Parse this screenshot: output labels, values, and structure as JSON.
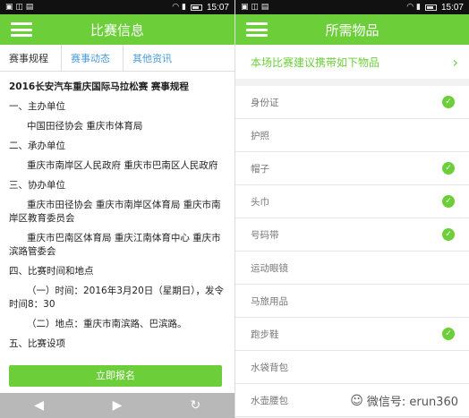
{
  "status": {
    "time": "15:07",
    "left_glyphs": "▣ ◫ ▤",
    "right_glyphs": "◠ ▮"
  },
  "left": {
    "title": "比赛信息",
    "tabs": [
      "赛事规程",
      "赛事动态",
      "其他资讯"
    ],
    "doc_title": "2016长安汽车重庆国际马拉松赛 赛事规程",
    "lines": [
      {
        "text": "一、主办单位",
        "style": ""
      },
      {
        "text": "中国田径协会  重庆市体育局",
        "style": "indent"
      },
      {
        "text": "二、承办单位",
        "style": ""
      },
      {
        "text": "重庆市南岸区人民政府  重庆市巴南区人民政府",
        "style": "indent"
      },
      {
        "text": "三、协办单位",
        "style": ""
      },
      {
        "text": "重庆市田径协会  重庆市南岸区体育局  重庆市南岸区教育委员会",
        "style": "indent-para"
      },
      {
        "text": "重庆市巴南区体育局  重庆江南体育中心  重庆市滨路管委会",
        "style": "indent-para"
      },
      {
        "text": "四、比赛时间和地点",
        "style": ""
      },
      {
        "text": "（一）时间：2016年3月20日（星期日），发令时间8：30",
        "style": "indent-para"
      },
      {
        "text": "（二）地点：重庆市南滨路、巴滨路。",
        "style": "indent-para"
      },
      {
        "text": "五、比赛设项",
        "style": ""
      }
    ],
    "signup_label": "立即报名",
    "nav": {
      "back": "◀",
      "forward": "▶",
      "refresh": "↻"
    }
  },
  "right": {
    "title": "所需物品",
    "recommend_text": "本场比赛建议携带如下物品",
    "items": [
      {
        "label": "身份证",
        "checked": true
      },
      {
        "label": "护照",
        "checked": false
      },
      {
        "label": "帽子",
        "checked": true
      },
      {
        "label": "头巾",
        "checked": true
      },
      {
        "label": "号码带",
        "checked": true
      },
      {
        "label": "运动眼镜",
        "checked": false
      },
      {
        "label": "马旅用品",
        "checked": false
      },
      {
        "label": "跑步鞋",
        "checked": true
      },
      {
        "label": "水袋背包",
        "checked": false
      },
      {
        "label": "水壶腰包",
        "checked": false
      }
    ],
    "watermark": "微信号: erun360"
  },
  "colors": {
    "accent": "#6ccf3a",
    "tab_blue": "#4a9ad8"
  }
}
